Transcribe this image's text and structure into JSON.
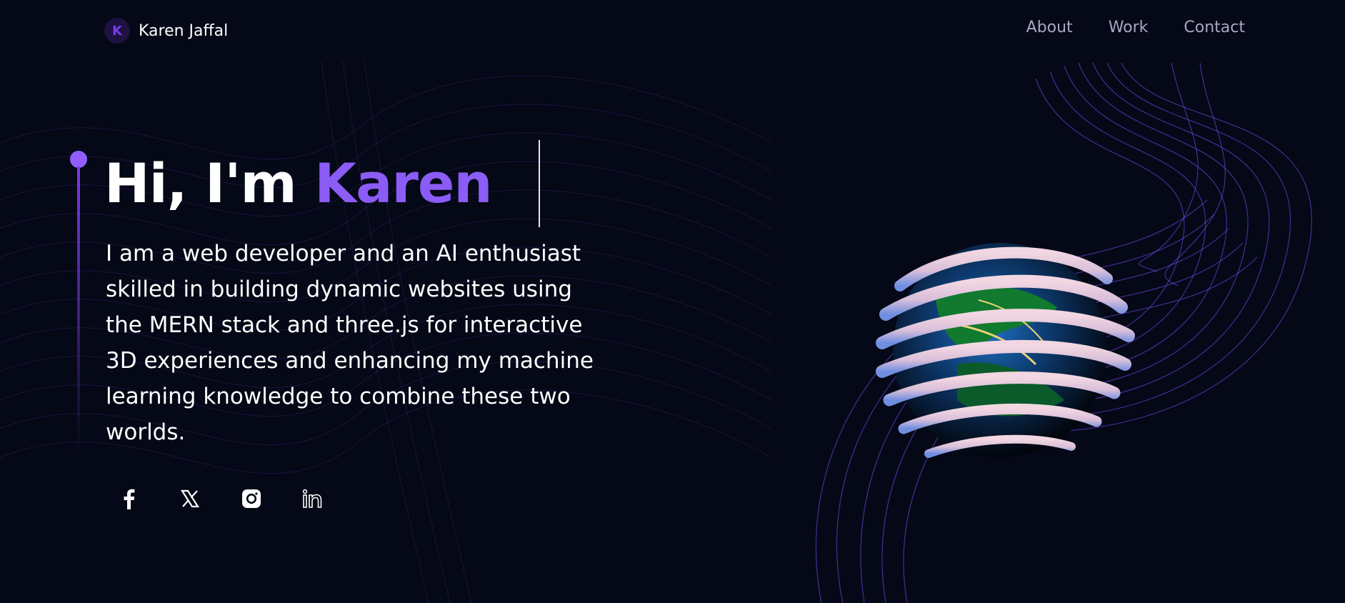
{
  "nav": {
    "logo_letter": "K",
    "logo_text": "Karen Jaffal",
    "links": [
      {
        "label": "About"
      },
      {
        "label": "Work"
      },
      {
        "label": "Contact"
      }
    ]
  },
  "hero": {
    "greeting": "Hi, I'm",
    "name": "Karen",
    "bio": "I am a web developer and an AI enthusiast skilled in building dynamic websites using the MERN stack and three.js for interactive 3D experiences and enhancing my machine learning knowledge to combine these two worlds."
  },
  "socials": [
    {
      "icon": "facebook-icon"
    },
    {
      "icon": "x-icon"
    },
    {
      "icon": "instagram-icon"
    },
    {
      "icon": "linkedin-icon"
    }
  ],
  "colors": {
    "background": "#050816",
    "accent": "#8b5cf6",
    "nav_text": "#aaa6c3",
    "dot": "#915eff"
  }
}
